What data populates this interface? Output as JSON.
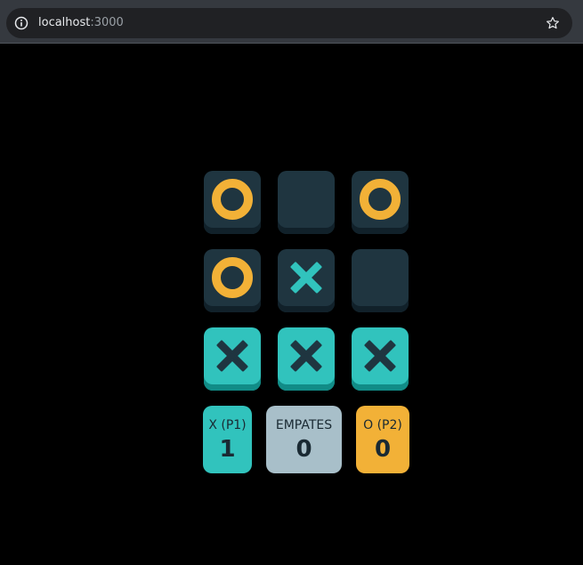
{
  "browser": {
    "url_host": "localhost",
    "url_port": ":3000"
  },
  "board": {
    "cells": [
      "O",
      "",
      "O",
      "O",
      "X",
      "",
      "X",
      "X",
      "X"
    ],
    "winning_line": [
      6,
      7,
      8
    ]
  },
  "scores": {
    "x": {
      "label": "X (P1)",
      "value": "1"
    },
    "ties": {
      "label": "EMPATES",
      "value": "0"
    },
    "o": {
      "label": "O (P2)",
      "value": "0"
    }
  },
  "colors": {
    "x": "#31c3bd",
    "o": "#f2b137",
    "tile": "#1f3540",
    "ties": "#a8bfc9",
    "dark_text": "#1a2a33"
  }
}
